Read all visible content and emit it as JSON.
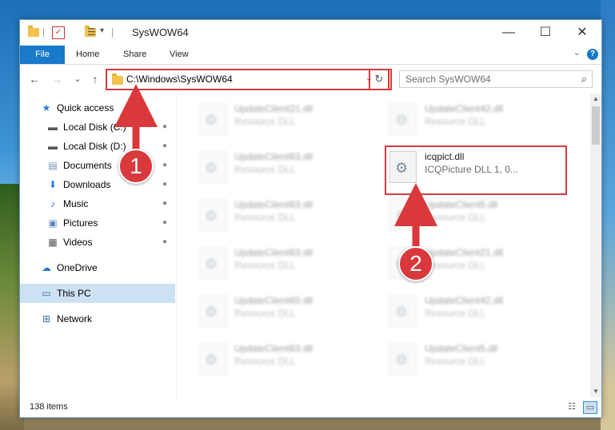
{
  "window": {
    "title": "SysWOW64",
    "controls": {
      "minimize": "—",
      "maximize": "☐",
      "close": "✕"
    }
  },
  "ribbon": {
    "tabs": [
      "File",
      "Home",
      "Share",
      "View"
    ],
    "help": "?"
  },
  "nav": {
    "back": "←",
    "forward": "→",
    "recent": "⌄",
    "up": "↑",
    "address": "C:\\Windows\\SysWOW64",
    "search_placeholder": "Search SysWOW64"
  },
  "sidebar": {
    "items": [
      {
        "label": "Quick access",
        "icon": "★"
      },
      {
        "label": "Local Disk (C:)",
        "icon": "▬",
        "pinned": true
      },
      {
        "label": "Local Disk (D:)",
        "icon": "▬",
        "pinned": true
      },
      {
        "label": "Documents",
        "icon": "▤",
        "pinned": true
      },
      {
        "label": "Downloads",
        "icon": "⬇",
        "pinned": true
      },
      {
        "label": "Music",
        "icon": "♪",
        "pinned": true
      },
      {
        "label": "Pictures",
        "icon": "▣",
        "pinned": true
      },
      {
        "label": "Videos",
        "icon": "▦",
        "pinned": true
      },
      {
        "label": "OneDrive",
        "icon": "☁"
      },
      {
        "label": "This PC",
        "icon": "▭"
      },
      {
        "label": "Network",
        "icon": "⊞"
      }
    ],
    "pin_glyph": "📌"
  },
  "files": [
    {
      "name": "UpdateClient21.dll",
      "desc": "Resource DLL"
    },
    {
      "name": "UpdateClient42.dll",
      "desc": "Resource DLL"
    },
    {
      "name": "UpdateClient63.dll",
      "desc": "Resource DLL"
    },
    {
      "name": "icqpict.dll",
      "desc": "ICQPicture DLL 1, 0..."
    },
    {
      "name": "UpdateClient63.dll",
      "desc": "Resource DLL"
    },
    {
      "name": "UpdateClient5.dll",
      "desc": "Resource DLL"
    },
    {
      "name": "UpdateClient63.dll",
      "desc": "Resource DLL"
    },
    {
      "name": "UpdateClient21.dll",
      "desc": "Resource DLL"
    },
    {
      "name": "UpdateClient65.dll",
      "desc": "Resource DLL"
    },
    {
      "name": "UpdateClient42.dll",
      "desc": "Resource DLL"
    },
    {
      "name": "UpdateClient63.dll",
      "desc": "Resource DLL"
    },
    {
      "name": "UpdateClient5.dll",
      "desc": "Resource DLL"
    }
  ],
  "status": {
    "item_count": "138 items"
  },
  "annotations": {
    "step1": "1",
    "step2": "2"
  },
  "colors": {
    "accent": "#1979ca",
    "highlight": "#d9393c",
    "selection": "#cde1f4"
  }
}
